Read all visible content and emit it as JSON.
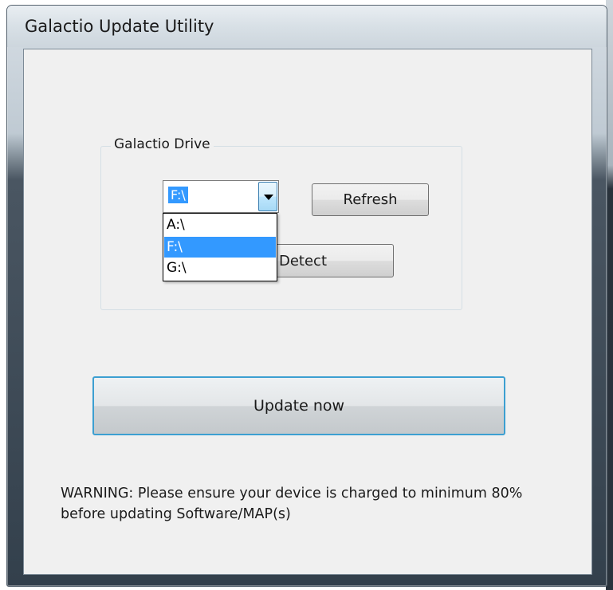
{
  "window": {
    "title": "Galactio Update Utility"
  },
  "group": {
    "label": "Galactio Drive"
  },
  "drive_combo": {
    "selected": "F:\\",
    "options": [
      {
        "label": "A:\\",
        "selected": false
      },
      {
        "label": "F:\\",
        "selected": true
      },
      {
        "label": "G:\\",
        "selected": false
      }
    ]
  },
  "buttons": {
    "refresh": "Refresh",
    "detect": "Detect",
    "update": "Update now"
  },
  "warning": {
    "line1": "WARNING: Please ensure your device is charged to minimum 80%",
    "line2": "before updating Software/MAP(s)"
  },
  "colors": {
    "selection": "#3399ff",
    "button_focus_border": "#3c9fd1"
  }
}
